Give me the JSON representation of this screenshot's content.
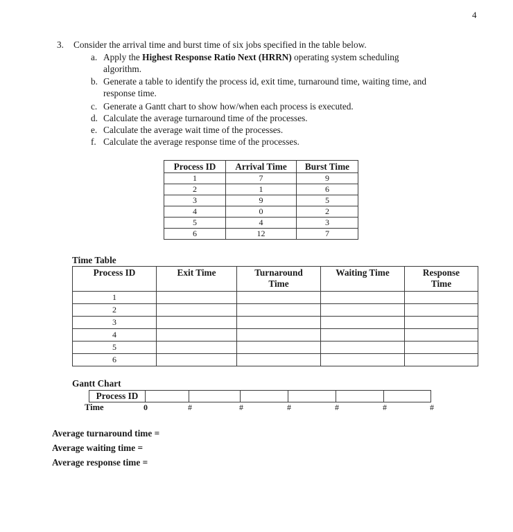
{
  "page_number": "4",
  "question": {
    "number": "3.",
    "text": "Consider the arrival time and burst time of six jobs specified in the table below.",
    "subparts": [
      {
        "label": "a.",
        "lines": [
          {
            "pre": "Apply the ",
            "bold": "Highest Response Ratio Next (HRRN)",
            "post": " operating system scheduling"
          },
          {
            "pre": "algorithm.",
            "bold": "",
            "post": ""
          }
        ]
      },
      {
        "label": "b.",
        "lines": [
          {
            "pre": "Generate a table to identify the process id, exit time, turnaround time, waiting time, and",
            "bold": "",
            "post": ""
          },
          {
            "pre": "response time.",
            "bold": "",
            "post": ""
          }
        ]
      },
      {
        "label": "c.",
        "lines": [
          {
            "pre": "Generate a Gantt chart to show how/when each process is executed.",
            "bold": "",
            "post": ""
          }
        ]
      },
      {
        "label": "d.",
        "lines": [
          {
            "pre": "Calculate the average turnaround time of the processes.",
            "bold": "",
            "post": ""
          }
        ]
      },
      {
        "label": "e.",
        "lines": [
          {
            "pre": "Calculate the average wait time of the processes.",
            "bold": "",
            "post": ""
          }
        ]
      },
      {
        "label": "f.",
        "lines": [
          {
            "pre": "Calculate the average response time of the processes.",
            "bold": "",
            "post": ""
          }
        ]
      }
    ]
  },
  "jobs_table": {
    "headers": [
      "Process ID",
      "Arrival Time",
      "Burst Time"
    ],
    "rows": [
      [
        "1",
        "7",
        "9"
      ],
      [
        "2",
        "1",
        "6"
      ],
      [
        "3",
        "9",
        "5"
      ],
      [
        "4",
        "0",
        "2"
      ],
      [
        "5",
        "4",
        "3"
      ],
      [
        "6",
        "12",
        "7"
      ]
    ]
  },
  "time_table": {
    "title": "Time Table",
    "headers": [
      "Process ID",
      "Exit Time",
      "Turnaround Time",
      "Waiting Time",
      "Response Time"
    ],
    "rows": [
      [
        "1",
        "",
        "",
        "",
        ""
      ],
      [
        "2",
        "",
        "",
        "",
        ""
      ],
      [
        "3",
        "",
        "",
        "",
        ""
      ],
      [
        "4",
        "",
        "",
        "",
        ""
      ],
      [
        "5",
        "",
        "",
        "",
        ""
      ],
      [
        "6",
        "",
        "",
        "",
        ""
      ]
    ]
  },
  "gantt": {
    "title": "Gantt Chart",
    "row_label": "Process ID",
    "time_label": "Time",
    "cells": [
      "",
      "",
      "",
      "",
      "",
      ""
    ],
    "ticks": [
      "0",
      "#",
      "#",
      "#",
      "#",
      "#",
      "#"
    ]
  },
  "averages": [
    "Average turnaround time =",
    "Average waiting time =",
    "Average response time ="
  ]
}
